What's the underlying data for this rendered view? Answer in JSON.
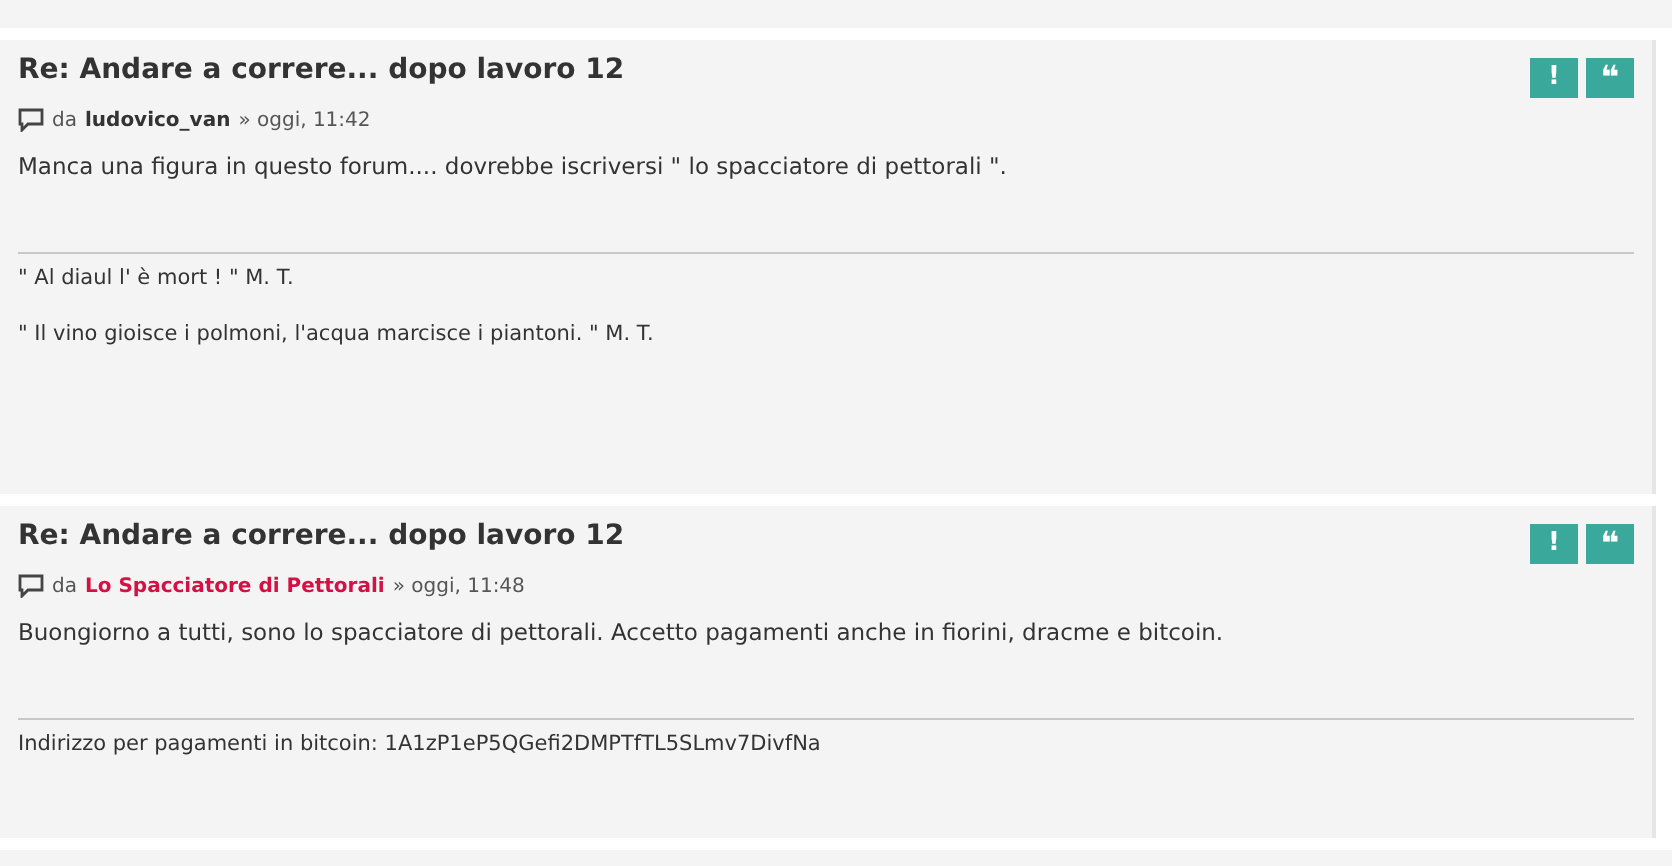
{
  "posts": [
    {
      "title": "Re: Andare a correre... dopo lavoro 12",
      "by": "da",
      "author": "ludovico_van",
      "color": "#333333",
      "time": "» oggi, 11:42",
      "body": "Manca una figura in questo forum.... dovrebbe iscriversi \" lo spacciatore di pettorali \".",
      "signature": [
        "\" Al diaul l' è mort ! \" M. T.",
        "\" Il vino gioisce i polmoni, l'acqua marcisce i piantoni. \" M. T."
      ],
      "buttons": [
        {
          "kind": "report",
          "label": "!"
        },
        {
          "kind": "quote",
          "label": "❝"
        }
      ]
    },
    {
      "title": "Re: Andare a correre... dopo lavoro 12",
      "by": "da",
      "author": "Lo Spacciatore di Pettorali",
      "color": "#d31145",
      "time": "» oggi, 11:48",
      "body": "Buongiorno a tutti, sono lo spacciatore di pettorali. Accetto pagamenti anche in fiorini, dracme e bitcoin.",
      "signature": [
        "Indirizzo per pagamenti in bitcoin: 1A1zP1eP5QGefi2DMPTfTL5SLmv7DivfNa"
      ],
      "buttons": [
        {
          "kind": "report",
          "label": "!"
        },
        {
          "kind": "quote",
          "label": "❝"
        }
      ]
    }
  ]
}
